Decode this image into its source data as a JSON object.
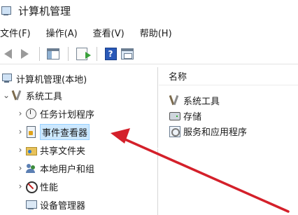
{
  "window": {
    "title": "计算机管理",
    "icon": "computer-management-icon"
  },
  "menu": {
    "items": [
      "文件(F)",
      "操作(A)",
      "查看(V)",
      "帮助(H)"
    ]
  },
  "toolbar": {
    "buttons": [
      "back-icon",
      "forward-icon",
      "show-hide-tree-icon",
      "export-list-icon",
      "help-icon",
      "view-icon"
    ]
  },
  "tree": {
    "root": "计算机管理(本地)",
    "system_tools": "系统工具",
    "items": [
      {
        "label": "任务计划程序",
        "icon": "clock-icon"
      },
      {
        "label": "事件查看器",
        "icon": "event-viewer-icon"
      },
      {
        "label": "共享文件夹",
        "icon": "shared-folder-icon"
      },
      {
        "label": "本地用户和组",
        "icon": "users-icon"
      },
      {
        "label": "性能",
        "icon": "performance-icon"
      },
      {
        "label": "设备管理器",
        "icon": "device-manager-icon"
      }
    ]
  },
  "details": {
    "header": "名称",
    "items": [
      {
        "label": "系统工具",
        "icon": "tools-icon"
      },
      {
        "label": "存储",
        "icon": "storage-icon"
      },
      {
        "label": "服务和应用程序",
        "icon": "services-icon"
      }
    ]
  },
  "colors": {
    "selection": "#cce8ff",
    "annotation_arrow": "#d4202a"
  }
}
